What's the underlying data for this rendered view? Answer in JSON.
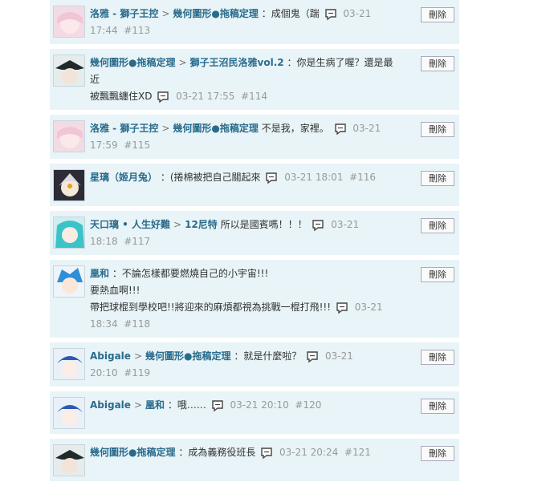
{
  "delete_label": "刪除",
  "messages": [
    {
      "from": "洛雅 - 獅子王控",
      "to": "幾何圖形●拖稿定理",
      "text": "：成個鬼（踹",
      "time": "03-21",
      "time2": "17:44",
      "num": "#113"
    },
    {
      "from": "幾何圖形●拖稿定理",
      "to": "獅子王沼民洛雅vol.2",
      "text": "：你是生病了喔？還是最近",
      "text2": "被飄飄纏住XD",
      "time": "03-21 17:55",
      "num": "#114"
    },
    {
      "from": "洛雅 - 獅子王控",
      "to": "幾何圖形●拖稿定理",
      "text": "不是我，家裡。",
      "time": "03-21",
      "time2": "17:59",
      "num": "#115"
    },
    {
      "from": "星璃（姬月兔）",
      "text": "：(捲棉被把自己關起來",
      "time": "03-21 18:01",
      "num": "#116"
    },
    {
      "from": "天口璃 • 人生好難",
      "to": "12尼特",
      "text": "所以是國賓嗎！！！",
      "time": "03-21",
      "time2": "18:18",
      "num": "#117"
    },
    {
      "from": "凰和",
      "text": "：不論怎樣都要燃燒自己的小宇宙!!!",
      "text2": "要熱血啊!!!",
      "text3": "帶把球棍到學校吧!!將迎來的麻煩都視為挑戰一棍打飛!!!",
      "time": "03-21 18:34",
      "num": "#118"
    },
    {
      "from": "Abigale",
      "to": "幾何圖形●拖稿定理",
      "text": "：就是什麼啦？",
      "time": "03-21 20:10",
      "num": "#119"
    },
    {
      "from": "Abigale",
      "to": "凰和",
      "text": "：哦……",
      "time": "03-21 20:10",
      "num": "#120"
    },
    {
      "from": "幾何圖形●拖稿定理",
      "text": "：成為義務役班長",
      "time": "03-21 20:24",
      "num": "#121"
    }
  ]
}
